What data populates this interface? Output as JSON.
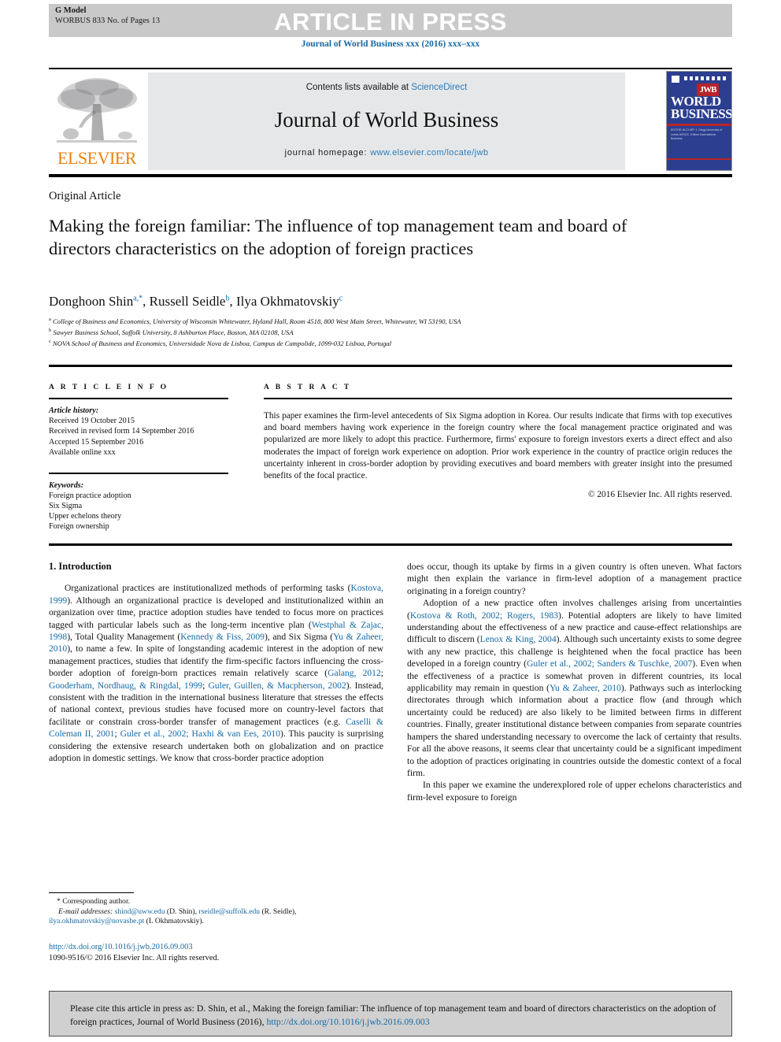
{
  "banner": {
    "g_model": "G Model",
    "model_id": "WORBUS 833 No. of Pages 13",
    "article_in_press": "ARTICLE IN PRESS"
  },
  "journal_ref": "Journal of World Business xxx (2016) xxx–xxx",
  "masthead": {
    "publisher": "ELSEVIER",
    "contents_prefix": "Contents lists available at ",
    "contents_link": "ScienceDirect",
    "journal_title": "Journal of World Business",
    "homepage_label": "journal homepage: ",
    "homepage_url": "www.elsevier.com/locate/jwb",
    "cover": {
      "badge": "JWB",
      "title_line1": "WORLD",
      "title_line2": "BUSINESS",
      "small_block": "EDITOR-IN-CHIEF\nJ. Clegg\nUniversity of Leeds\nASSOC. Editors\nInternational Business"
    }
  },
  "article": {
    "type": "Original Article",
    "title": "Making the foreign familiar: The influence of top management team and board of directors characteristics on the adoption of foreign practices",
    "authors_html": "Donghoon Shin<sup>a,*</sup>, Russell Seidle<sup>b</sup>, Ilya Okhmatovskiy<sup>c</sup>",
    "affiliations": [
      "College of Business and Economics, University of Wisconsin Whitewater, Hyland Hall, Room 4518, 800 West Main Street, Whitewater, WI 53190, USA",
      "Sawyer Business School, Suffolk University, 8 Ashburton Place, Boston, MA 02108, USA",
      "NOVA School of Business and Economics, Universidade Nova de Lisboa, Campus de Campolide, 1099-032 Lisboa, Portugal"
    ],
    "affiliation_marks": [
      "a",
      "b",
      "c"
    ]
  },
  "article_info": {
    "label": "A R T I C L E   I N F O",
    "history_label": "Article history:",
    "history": [
      "Received 19 October 2015",
      "Received in revised form 14 September 2016",
      "Accepted 15 September 2016",
      "Available online xxx"
    ],
    "keywords_label": "Keywords:",
    "keywords": [
      "Foreign practice adoption",
      "Six Sigma",
      "Upper echelons theory",
      "Foreign ownership"
    ]
  },
  "abstract": {
    "label": "A B S T R A C T",
    "text": "This paper examines the firm-level antecedents of Six Sigma adoption in Korea. Our results indicate that firms with top executives and board members having work experience in the foreign country where the focal management practice originated and was popularized are more likely to adopt this practice. Furthermore, firms' exposure to foreign investors exerts a direct effect and also moderates the impact of foreign work experience on adoption. Prior work experience in the country of practice origin reduces the uncertainty inherent in cross-border adoption by providing executives and board members with greater insight into the presumed benefits of the focal practice.",
    "copyright": "© 2016 Elsevier Inc. All rights reserved."
  },
  "intro": {
    "heading": "1. Introduction",
    "left_paragraphs": [
      {
        "parts": [
          {
            "t": "Organizational practices are institutionalized methods of performing tasks ("
          },
          {
            "t": "Kostova, 1999",
            "ref": true
          },
          {
            "t": "). Although an organizational practice is developed and institutionalized within an organization over time, practice adoption studies have tended to focus more on practices tagged with particular labels such as the long-term incentive plan ("
          },
          {
            "t": "Westphal & Zajac, 1998",
            "ref": true
          },
          {
            "t": "), Total Quality Management ("
          },
          {
            "t": "Kennedy & Fiss, 2009",
            "ref": true
          },
          {
            "t": "), and Six Sigma ("
          },
          {
            "t": "Yu & Zaheer, 2010",
            "ref": true
          },
          {
            "t": "), to name a few. In spite of longstanding academic interest in the adoption of new management practices, studies that identify the firm-specific factors influencing the cross-border adoption of foreign-born practices remain relatively scarce ("
          },
          {
            "t": "Galang, 2012",
            "ref": true
          },
          {
            "t": "; "
          },
          {
            "t": "Gooderham, Nordhaug, & Ringdal, 1999",
            "ref": true
          },
          {
            "t": "; "
          },
          {
            "t": "Guler, Guillen, & Macpherson, 2002",
            "ref": true
          },
          {
            "t": "). Instead, consistent with the tradition in the international business literature that stresses the effects of national context, previous studies have focused more on country-level factors that facilitate or constrain cross-border transfer of management practices (e.g. "
          },
          {
            "t": "Caselli & Coleman II, 2001",
            "ref": true
          },
          {
            "t": "; "
          },
          {
            "t": "Guler et al., 2002; Haxhi & van Ees, 2010",
            "ref": true
          },
          {
            "t": "). This paucity is surprising considering the extensive research undertaken both on globalization and on practice adoption in domestic settings. We know that cross-border practice adoption"
          }
        ]
      }
    ],
    "right_paragraphs": [
      {
        "indent": false,
        "parts": [
          {
            "t": "does occur, though its uptake by firms in a given country is often uneven. What factors might then explain the variance in firm-level adoption of a management practice originating in a foreign country?"
          }
        ]
      },
      {
        "indent": true,
        "parts": [
          {
            "t": "Adoption of a new practice often involves challenges arising from uncertainties ("
          },
          {
            "t": "Kostova & Roth, 2002; Rogers, 1983",
            "ref": true
          },
          {
            "t": "). Potential adopters are likely to have limited understanding about the effectiveness of a new practice and cause-effect relationships are difficult to discern ("
          },
          {
            "t": "Lenox & King, 2004",
            "ref": true
          },
          {
            "t": "). Although such uncertainty exists to some degree with any new practice, this challenge is heightened when the focal practice has been developed in a foreign country ("
          },
          {
            "t": "Guler et al., 2002; Sanders & Tuschke, 2007",
            "ref": true
          },
          {
            "t": "). Even when the effectiveness of a practice is somewhat proven in different countries, its local applicability may remain in question ("
          },
          {
            "t": "Yu & Zaheer, 2010",
            "ref": true
          },
          {
            "t": "). Pathways such as interlocking directorates through which information about a practice flow (and through which uncertainty could be reduced) are also likely to be limited between firms in different countries. Finally, greater institutional distance between companies from separate countries hampers the shared understanding necessary to overcome the lack of certainty that results. For all the above reasons, it seems clear that uncertainty could be a significant impediment to the adoption of practices originating in countries outside the domestic context of a focal firm."
          }
        ]
      },
      {
        "indent": true,
        "parts": [
          {
            "t": "In this paper we examine the underexplored role of upper echelons characteristics and firm-level exposure to foreign"
          }
        ]
      }
    ]
  },
  "footnotes": {
    "corresponding_mark": "*",
    "corresponding_label": "Corresponding author.",
    "email_label": "E-mail addresses:",
    "emails": [
      {
        "addr": "shind@uww.edu",
        "who": " (D. Shin), "
      },
      {
        "addr": "rseidle@suffolk.edu",
        "who": " (R. Seidle), "
      },
      {
        "addr": "ilya.okhmatovskiy@novasbe.pt",
        "who": " (I. Okhmatovskiy)."
      }
    ]
  },
  "doi_block": {
    "doi_url": "http://dx.doi.org/10.1016/j.jwb.2016.09.003",
    "issn_line": "1090-9516/© 2016 Elsevier Inc. All rights reserved."
  },
  "cite_box": {
    "text_before": "Please cite this article in press as: D. Shin, et al., Making the foreign familiar: The influence of top management team and board of directors characteristics on the adoption of foreign practices, Journal of World Business (2016), ",
    "doi": "http://dx.doi.org/10.1016/j.jwb.2016.09.003"
  },
  "colors": {
    "link": "#1469a5",
    "banner_bg": "#c9c9c9",
    "masthead_bg": "#e6e7e8",
    "cite_bg": "#d0d0d0",
    "elsevier_orange": "#e8820c",
    "cover_blue": "#2c3e8f",
    "cover_red": "#b9242a"
  }
}
